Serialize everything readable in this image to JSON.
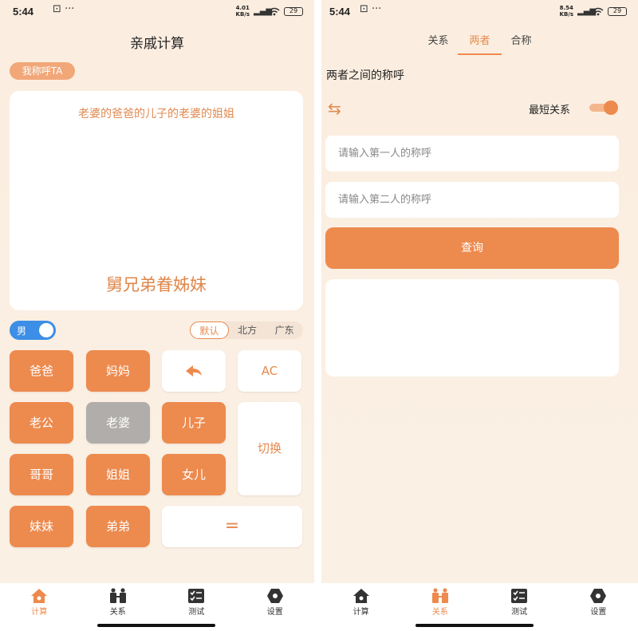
{
  "status_left": {
    "time": "5:44",
    "speed_top": "4.01",
    "speed_bottom": "KB/s",
    "battery": "29"
  },
  "status_right": {
    "time": "5:44",
    "speed_top": "8.54",
    "speed_bottom": "KB/s",
    "battery": "29"
  },
  "calc": {
    "title": "亲戚计算",
    "mode_label": "我称呼TA",
    "expression": "老婆的爸爸的儿子的老婆的姐姐",
    "result": "舅兄弟眷姊妹",
    "gender_label": "男",
    "dialects": [
      "默认",
      "北方",
      "广东"
    ],
    "keys": {
      "dad": "爸爸",
      "mom": "妈妈",
      "ac": "AC",
      "husband": "老公",
      "wife": "老婆",
      "son": "儿子",
      "switch": "切换",
      "elder_brother": "哥哥",
      "elder_sister": "姐姐",
      "daughter": "女儿",
      "younger_sister": "妹妹",
      "younger_brother": "弟弟",
      "equals": "="
    }
  },
  "nav_left": [
    "计算",
    "关系",
    "测试",
    "设置"
  ],
  "nav_right": [
    "计算",
    "关系",
    "测试",
    "设置"
  ],
  "relation": {
    "tabs": [
      "关系",
      "两者",
      "合称"
    ],
    "section_title": "两者之间的称呼",
    "shortest_label": "最短关系",
    "first_placeholder": "请输入第一人的称呼",
    "second_placeholder": "请输入第二人的称呼",
    "query_label": "查询"
  },
  "colors": {
    "accent": "#ed8a4e",
    "gray_key": "#b0adaa",
    "toggle_blue": "#3c8ee6"
  },
  "icons": [
    "home-icon",
    "people-icon",
    "checklist-icon",
    "settings-icon",
    "backspace-icon",
    "swap-icon",
    "wifi-icon",
    "signal-icon",
    "battery-icon"
  ]
}
